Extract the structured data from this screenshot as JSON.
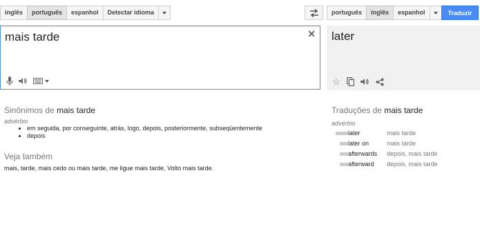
{
  "source_langs": [
    {
      "label": "inglês",
      "selected": false
    },
    {
      "label": "português",
      "selected": true
    },
    {
      "label": "espanhol",
      "selected": false
    },
    {
      "label": "Detectar idioma",
      "selected": false
    }
  ],
  "target_langs": [
    {
      "label": "português",
      "selected": false
    },
    {
      "label": "inglês",
      "selected": true
    },
    {
      "label": "espanhol",
      "selected": false
    }
  ],
  "translate_button": "Traduzir",
  "source_text": "mais tarde",
  "result_text": "later",
  "synonyms": {
    "title_prefix": "Sinônimos de",
    "term": "mais tarde",
    "pos": "advérbio",
    "items": [
      "em seguida, por conseguinte, atrás, logo, depois, posteriormente, subseqüentemente",
      "depois"
    ]
  },
  "see_also": {
    "title": "Veja também",
    "text": "mais, tarde, mais cedo ou mais tarde, me ligue mais tarde, Volto mais tarde."
  },
  "translations": {
    "title_prefix": "Traduções de",
    "term": "mais tarde",
    "pos": "advérbio",
    "rows": [
      {
        "word": "later",
        "back": "mais tarde",
        "frequency": 1.0
      },
      {
        "word": "later on",
        "back": "mais tarde",
        "frequency": 0.5
      },
      {
        "word": "afterwards",
        "back": "depois, mais tarde",
        "frequency": 0.5
      },
      {
        "word": "afterward",
        "back": "depois, mais tarde",
        "frequency": 0.5
      }
    ]
  },
  "colors": {
    "accent": "#4a8af4",
    "focus_border": "#4d90fe",
    "result_bg": "#f1f1f1"
  },
  "icons": [
    "swap-icon",
    "clear-icon",
    "microphone-icon",
    "speaker-icon",
    "keyboard-icon",
    "star-icon",
    "copy-icon",
    "share-icon"
  ]
}
